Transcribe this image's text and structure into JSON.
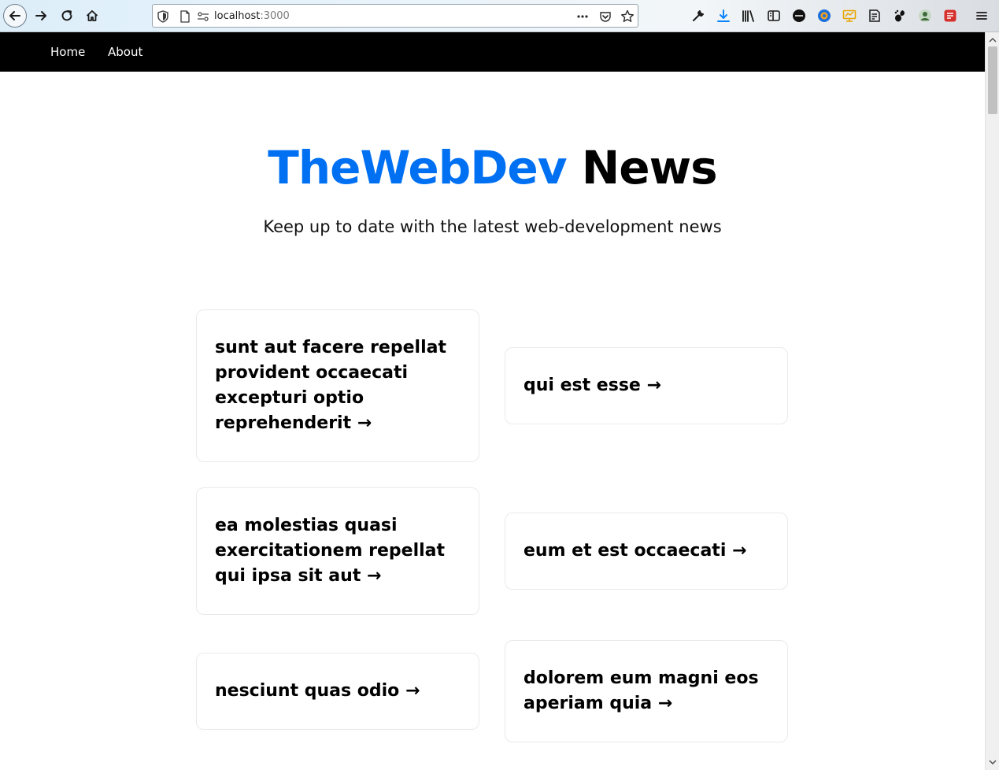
{
  "browser": {
    "url_host": "localhost",
    "url_port": ":3000"
  },
  "nav": {
    "items": [
      {
        "label": "Home"
      },
      {
        "label": "About"
      }
    ]
  },
  "hero": {
    "title_brand": "TheWebDev",
    "title_rest": " News",
    "subtitle": "Keep up to date with the latest web-development news"
  },
  "posts": [
    {
      "title": "sunt aut facere repellat provident occaecati excepturi optio reprehenderit →"
    },
    {
      "title": "qui est esse →"
    },
    {
      "title": "ea molestias quasi exercitationem repellat qui ipsa sit aut →"
    },
    {
      "title": "eum et est occaecati →"
    },
    {
      "title": "nesciunt quas odio →"
    },
    {
      "title": "dolorem eum magni eos aperiam quia →"
    }
  ],
  "colors": {
    "brand": "#0070f3",
    "nav_background": "#000000",
    "card_border": "#eaeaea"
  },
  "icons": {
    "toolbar": [
      "back-arrow-icon",
      "forward-arrow-icon",
      "reload-icon",
      "home-icon"
    ],
    "urlbar": [
      "tracking-shield-icon",
      "page-icon",
      "permissions-icon",
      "more-dots-icon",
      "pocket-icon",
      "bookmark-star-icon"
    ],
    "extensions": [
      "wrench-icon",
      "download-icon",
      "library-icon",
      "sidebar-icon",
      "extension-badge-icon",
      "globe-icon",
      "monitor-icon",
      "notes-icon",
      "gnome-icon",
      "user-icon",
      "puzzle-icon",
      "menu-icon"
    ]
  }
}
